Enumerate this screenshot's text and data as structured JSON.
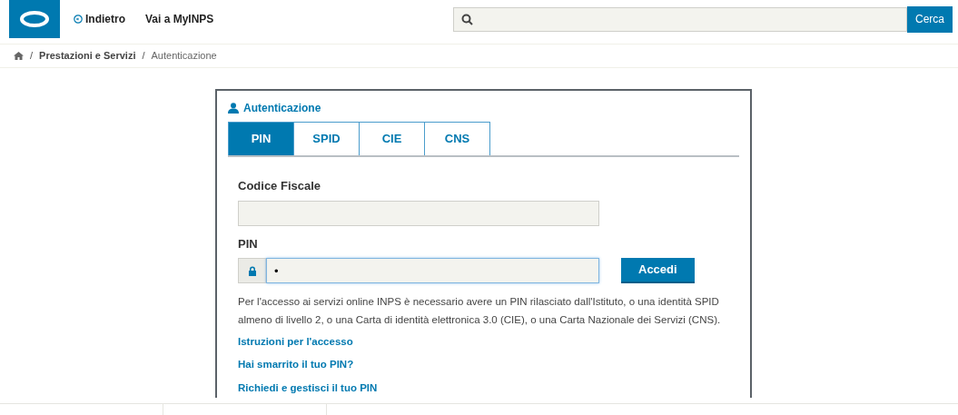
{
  "header": {
    "nav": [
      {
        "label": "Indietro",
        "kind": "back"
      },
      {
        "label": "Vai a MyINPS",
        "kind": "link"
      }
    ],
    "search": {
      "button": "Cerca"
    }
  },
  "breadcrumb": [
    {
      "separator": "/",
      "label": "Prestazioni e Servizi",
      "current": false
    },
    {
      "separator": "/",
      "label": "Autenticazione",
      "current": true
    }
  ],
  "panel": {
    "title": "Autenticazione",
    "tabs": [
      {
        "label": "PIN",
        "selected": true
      },
      {
        "label": "SPID",
        "selected": false
      },
      {
        "label": "CIE",
        "selected": false
      },
      {
        "label": "CNS",
        "selected": false
      }
    ],
    "fields": [
      {
        "label": "Codice Fiscale",
        "kind": "text",
        "focused": false
      },
      {
        "label": "PIN",
        "kind": "password",
        "value": "•",
        "focused": true
      }
    ],
    "submit": "Accedi",
    "note": "Per l'accesso ai servizi online INPS è necessario avere un PIN rilasciato dall'Istituto, o una identità SPID almeno di livello 2, o una Carta di identità elettronica 3.0 (CIE), o una Carta Nazionale dei Servizi (CNS).",
    "links": [
      "Istruzioni per l'accesso",
      "Hai smarrito il tuo PIN?",
      "Richiedi e gestisci il tuo PIN"
    ]
  }
}
